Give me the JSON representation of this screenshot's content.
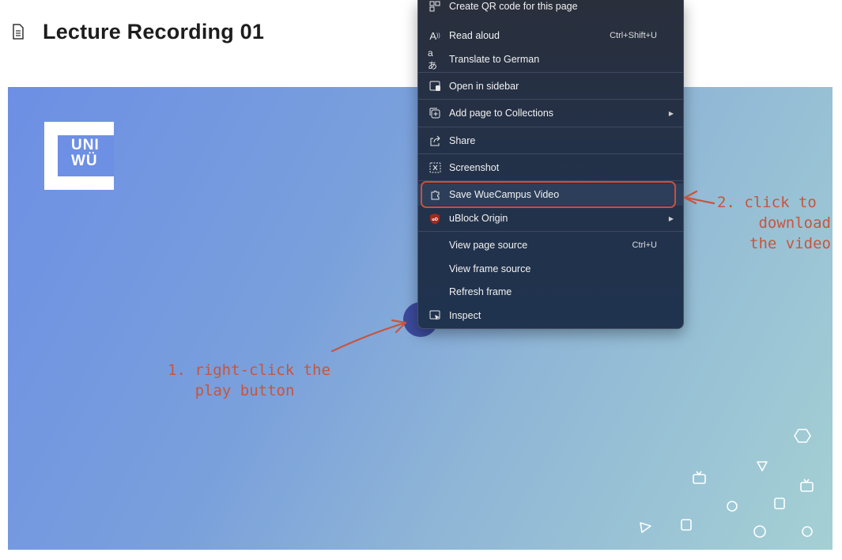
{
  "page": {
    "title": "Lecture Recording 01"
  },
  "logo": {
    "text_line1": "UNI",
    "text_line2": "WÜ"
  },
  "context_menu": {
    "items": [
      {
        "label": "Create QR code for this page",
        "icon": "qr-code-icon"
      },
      {
        "label": "Read aloud",
        "shortcut": "Ctrl+Shift+U",
        "icon": "read-aloud-icon"
      },
      {
        "label": "Translate to German",
        "icon": "translate-icon"
      },
      {
        "label": "Open in sidebar",
        "icon": "sidebar-icon"
      },
      {
        "label": "Add page to Collections",
        "icon": "collections-icon",
        "submenu": true
      },
      {
        "label": "Share",
        "icon": "share-icon"
      },
      {
        "label": "Screenshot",
        "icon": "screenshot-icon"
      },
      {
        "label": "Save WueCampus Video",
        "icon": "extension-icon",
        "highlighted": true
      },
      {
        "label": "uBlock Origin",
        "icon": "ublock-icon",
        "submenu": true
      },
      {
        "label": "View page source",
        "shortcut": "Ctrl+U"
      },
      {
        "label": "View frame source"
      },
      {
        "label": "Refresh frame"
      },
      {
        "label": "Inspect",
        "icon": "inspect-icon"
      }
    ]
  },
  "annotations": {
    "step1_line1": "1. right-click the",
    "step1_line2": "play button",
    "step2_line1": "2. click to",
    "step2_line2": "download",
    "step2_line3": "the video",
    "color": "#c8553d"
  },
  "colors": {
    "video_gradient_start": "#6d8fe4",
    "video_gradient_end": "#a4d0d4",
    "menu_background": "#233148"
  }
}
